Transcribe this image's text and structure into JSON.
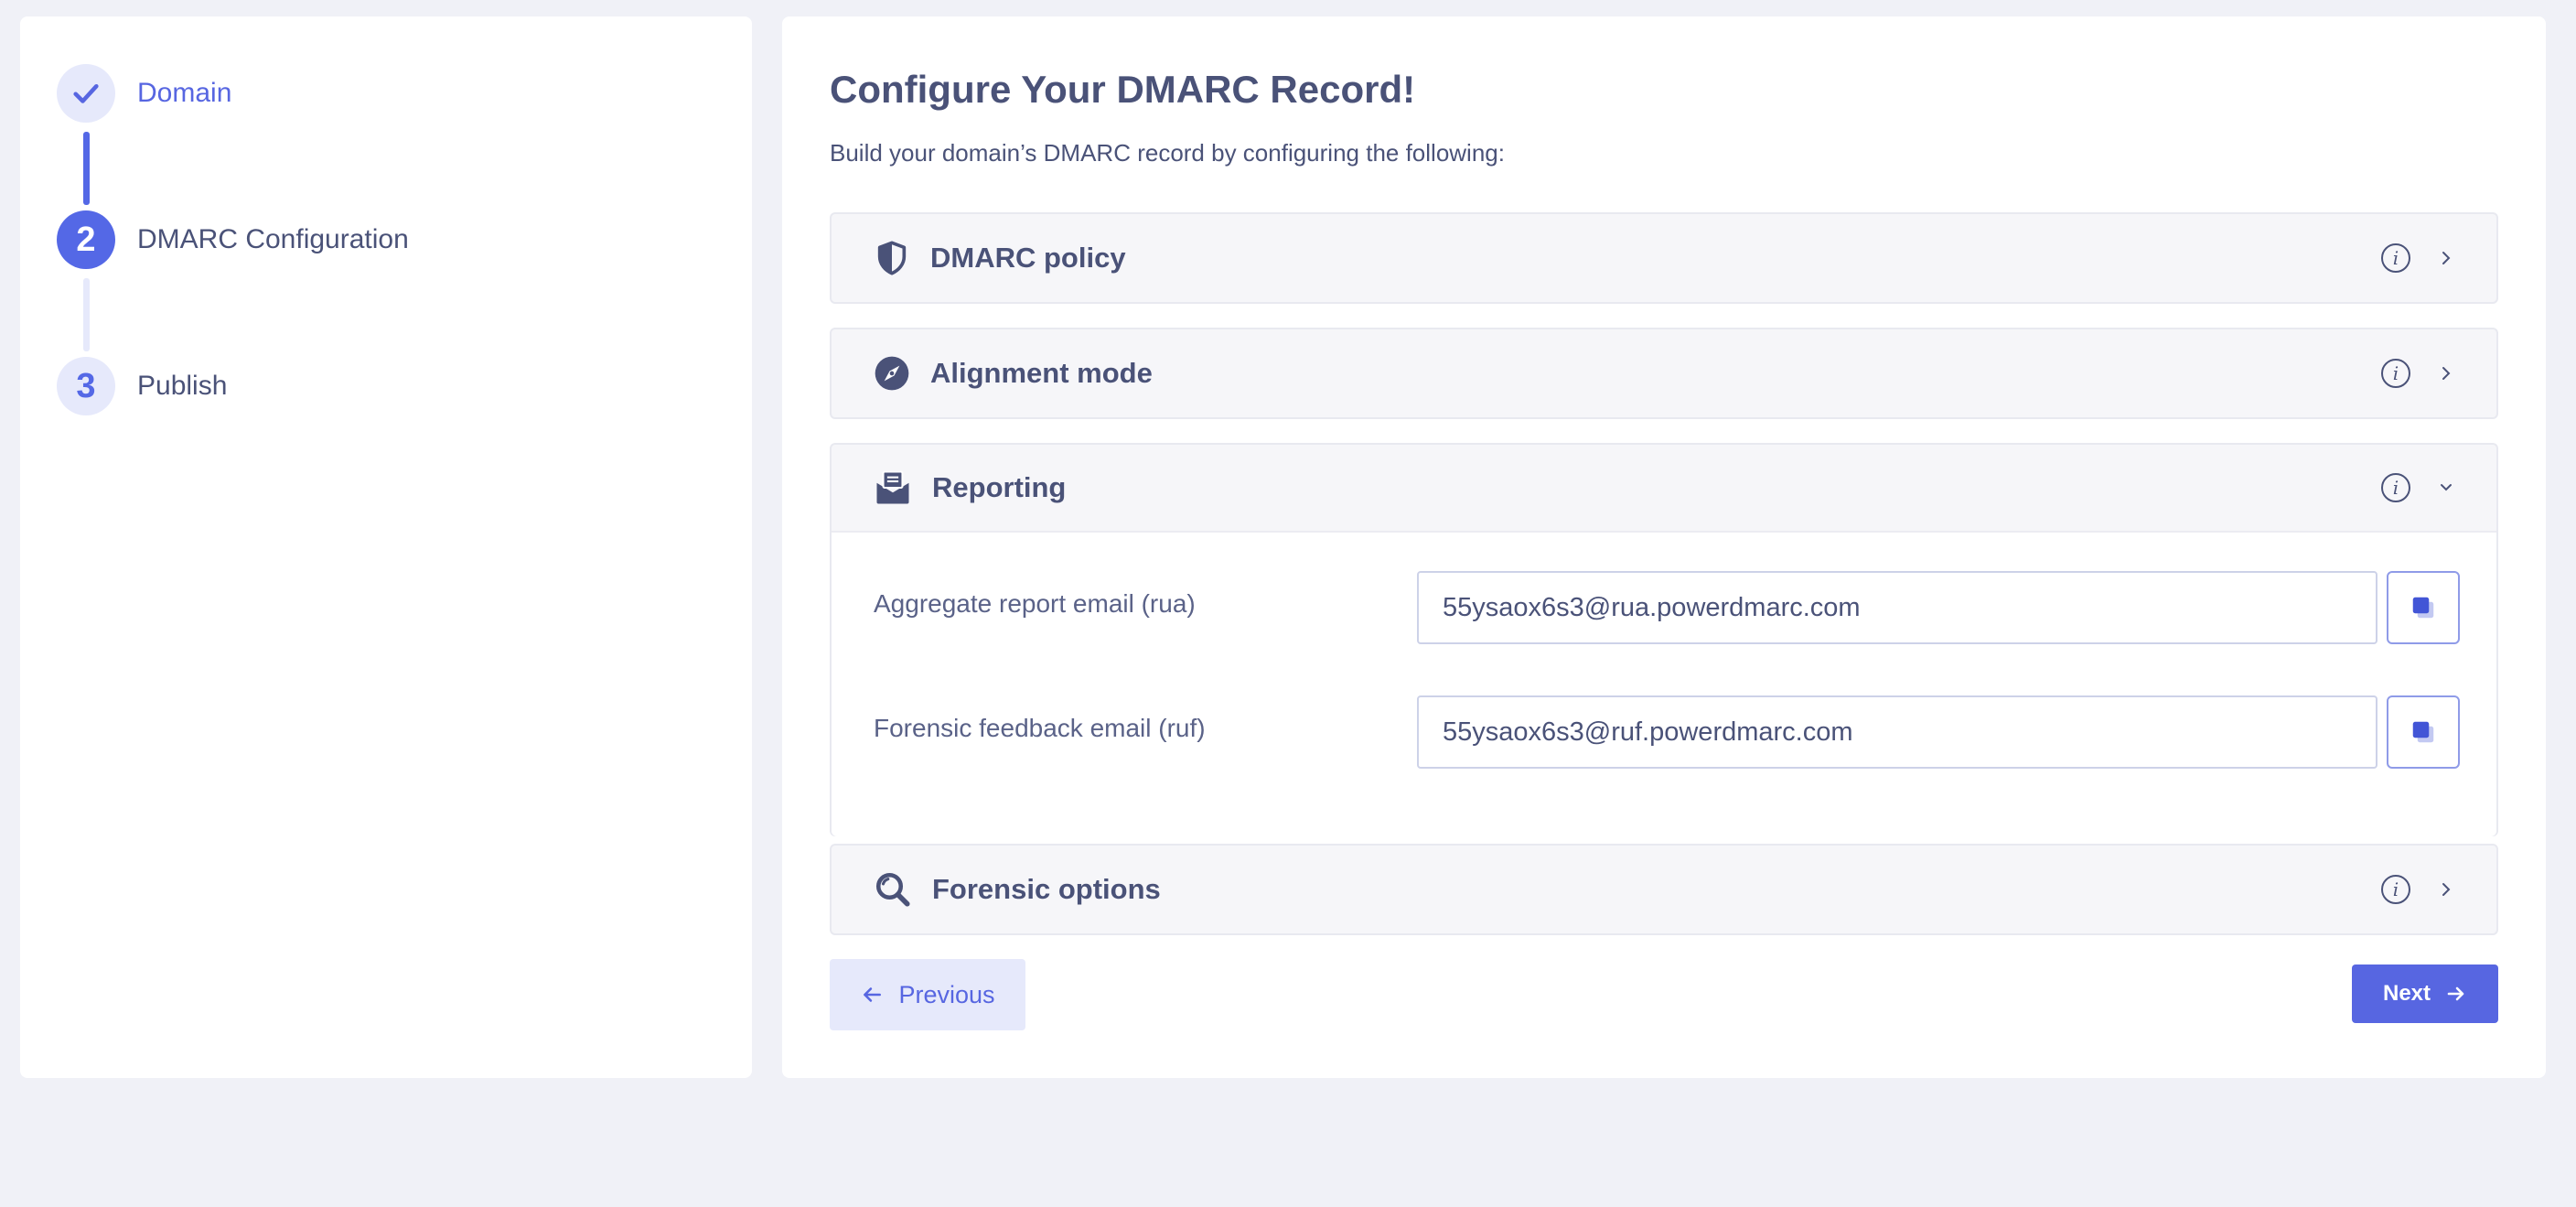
{
  "stepper": {
    "steps": [
      {
        "number": "",
        "label": "Domain",
        "state": "complete"
      },
      {
        "number": "2",
        "label": "DMARC Configuration",
        "state": "active"
      },
      {
        "number": "3",
        "label": "Publish",
        "state": "pending"
      }
    ]
  },
  "main": {
    "title": "Configure Your DMARC Record!",
    "subtitle": "Build your domain’s DMARC record by configuring the following:",
    "panels": [
      {
        "title": "DMARC policy",
        "icon": "shield-icon",
        "expanded": false
      },
      {
        "title": "Alignment mode",
        "icon": "compass-icon",
        "expanded": false
      },
      {
        "title": "Reporting",
        "icon": "mail-open-icon",
        "expanded": true
      },
      {
        "title": "Forensic options",
        "icon": "search-icon",
        "expanded": false
      }
    ],
    "reporting": {
      "rua_label": "Aggregate report email (rua)",
      "rua_value": "55ysaox6s3@rua.powerdmarc.com",
      "ruf_label": "Forensic feedback email (ruf)",
      "ruf_value": "55ysaox6s3@ruf.powerdmarc.com"
    },
    "buttons": {
      "previous": "Previous",
      "next": "Next"
    }
  },
  "colors": {
    "accent": "#5766e1",
    "accent_light": "#e6e9fb",
    "text": "#4a5278",
    "background": "#f0f1f7"
  }
}
